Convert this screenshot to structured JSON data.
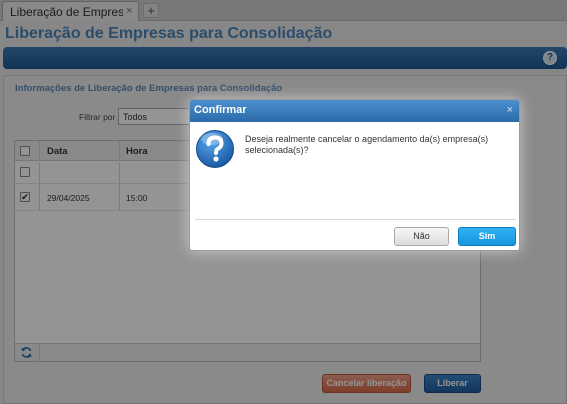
{
  "tabs": [
    {
      "label": "Liberação de Empresas p",
      "close": "×"
    }
  ],
  "tab_add": "+",
  "page": {
    "title": "Liberação de Empresas para Consolidação",
    "help": "?"
  },
  "section": {
    "title": "Informações de Liberação de Empresas para Consolidação"
  },
  "filter": {
    "label": "Filtrar por",
    "value": "Todos"
  },
  "grid": {
    "columns": [
      "Data",
      "Hora"
    ],
    "rows": [
      {
        "checked": false,
        "date": "",
        "time": ""
      },
      {
        "checked": true,
        "check_mark": "✔",
        "date": "29/04/2025",
        "time": "15:00"
      }
    ]
  },
  "actions": {
    "cancel_label": "Cancelar liberação",
    "release_label": "Liberar"
  },
  "dialog": {
    "title": "Confirmar",
    "close": "×",
    "message": "Deseja realmente cancelar o agendamento da(s) empresa(s) selecionada(s)?",
    "no_label": "Não",
    "yes_label": "Sim"
  },
  "colors": {
    "accent": "#2a6aa8",
    "title_text": "#4a86b8",
    "cancel_button": "#d9694a",
    "yes_button": "#1495df"
  }
}
